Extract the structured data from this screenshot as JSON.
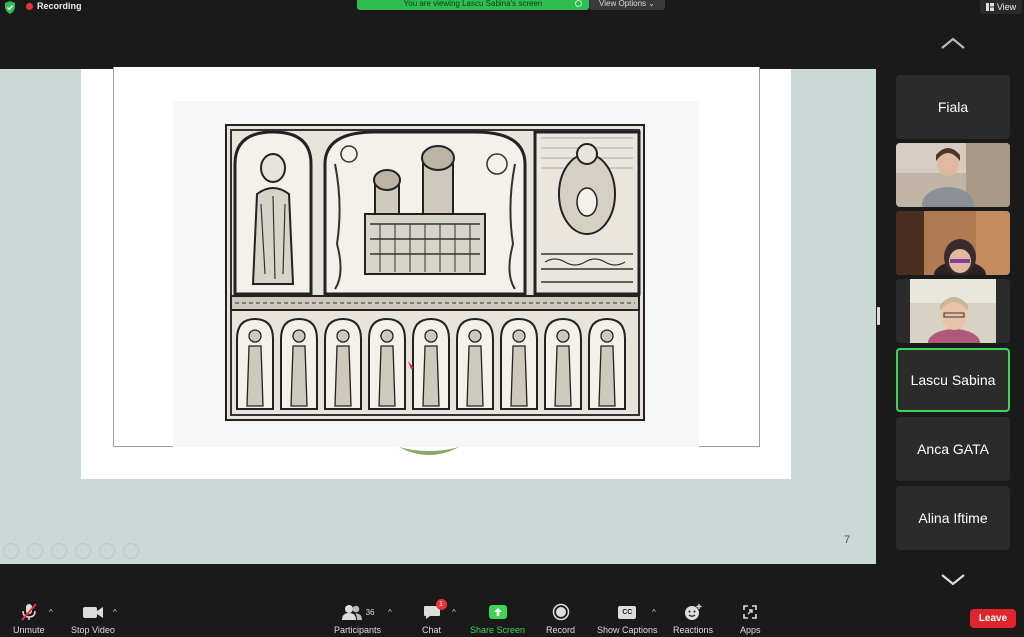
{
  "top_bar": {
    "recording_label": "Recording",
    "viewing_banner": "You are viewing Lascu Sabina's screen",
    "view_options_label": "View Options",
    "view_label": "View"
  },
  "shared_screen": {
    "page_number": "7"
  },
  "gallery": {
    "tiles": [
      {
        "name": "Fiala",
        "has_video": false,
        "active": false
      },
      {
        "name": "",
        "has_video": true,
        "active": false
      },
      {
        "name": "",
        "has_video": true,
        "active": false
      },
      {
        "name": "",
        "has_video": true,
        "active": false
      },
      {
        "name": "Lascu Sabina",
        "has_video": false,
        "active": true
      },
      {
        "name": "Anca GATA",
        "has_video": false,
        "active": false
      },
      {
        "name": "Alina Iftime",
        "has_video": false,
        "active": false
      }
    ]
  },
  "toolbar": {
    "unmute_label": "Unmute",
    "stop_video_label": "Stop Video",
    "participants_label": "Participants",
    "participants_count": "36",
    "chat_label": "Chat",
    "chat_badge": "1",
    "share_screen_label": "Share Screen",
    "record_label": "Record",
    "captions_label": "Show Captions",
    "captions_icon_text": "CC",
    "reactions_label": "Reactions",
    "apps_label": "Apps",
    "leave_label": "Leave"
  },
  "colors": {
    "background": "#1a1a1a",
    "share_green": "#3fd456",
    "banner_green": "#2fbd4f",
    "leave_red": "#e0262c",
    "recording_red": "#e8353b",
    "active_border": "#3fd456",
    "slide_backdrop": "#cbd9d6"
  }
}
